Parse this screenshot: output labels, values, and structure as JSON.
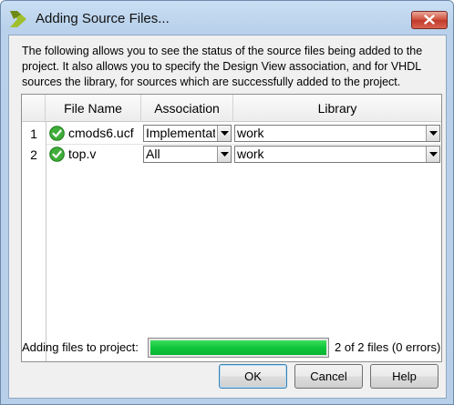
{
  "window": {
    "title": "Adding Source Files...",
    "close_icon": "close-icon"
  },
  "description": "The following allows you to see the status of the source files being added to the project.  It also allows you to specify the Design View association, and for VHDL sources the library, for sources which are successfully added to the project.",
  "table": {
    "headers": [
      "File Name",
      "Association",
      "Library"
    ],
    "rows": [
      {
        "num": "1",
        "status_icon": "check-icon",
        "file": "cmods6.ucf",
        "association": "Implementation",
        "library": "work"
      },
      {
        "num": "2",
        "status_icon": "check-icon",
        "file": "top.v",
        "association": "All",
        "library": "work"
      }
    ]
  },
  "progress": {
    "label": "Adding files to project:",
    "fraction": 1.0,
    "status": "2 of 2 files (0 errors)",
    "color": "#10c53a"
  },
  "buttons": {
    "ok": "OK",
    "cancel": "Cancel",
    "help": "Help"
  }
}
